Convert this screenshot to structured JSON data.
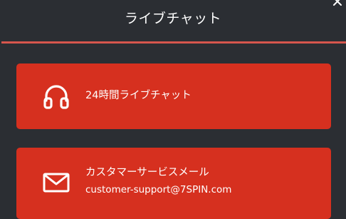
{
  "header": {
    "title": "ライブチャット",
    "close_icon": "close-icon"
  },
  "colors": {
    "background": "#2b2e33",
    "accent_line": "#d6564d",
    "card": "#d6301f",
    "text": "#ffffff"
  },
  "options": [
    {
      "icon": "headphones-icon",
      "label": "24時間ライブチャット"
    },
    {
      "icon": "envelope-icon",
      "label": "カスタマーサービスメール",
      "email": "customer-support@7SPIN.com"
    }
  ]
}
